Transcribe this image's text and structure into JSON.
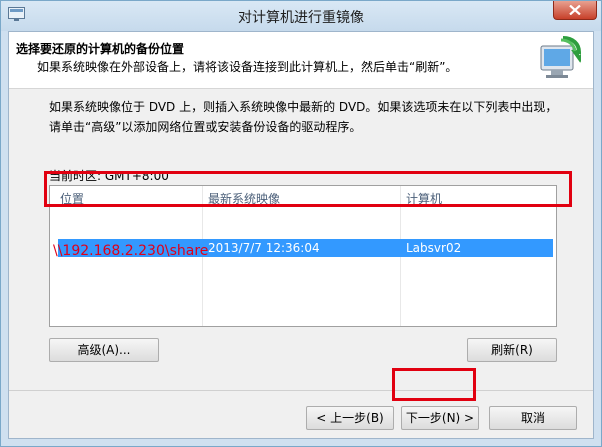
{
  "window": {
    "title": "对计算机进行重镜像"
  },
  "header": {
    "title": "选择要还原的计算机的备份位置",
    "subtitle": "如果系统映像在外部设备上，请将该设备连接到此计算机上，然后单击“刷新”。"
  },
  "description": "如果系统映像位于 DVD 上，则插入系统映像中最新的 DVD。如果该选项未在以下列表中出现，请单击“高级”以添加网络位置或安装备份设备的驱动程序。",
  "timezone": "当前时区: GMT+8:00",
  "table": {
    "columns": [
      "位置",
      "最新系统映像",
      "计算机"
    ],
    "rows": [
      {
        "location": "\\\\192.168.2.230\\share",
        "latest_image": "2013/7/7 12:36:04",
        "computer": "Labsvr02"
      }
    ]
  },
  "buttons": {
    "advanced": "高级(A)...",
    "refresh": "刷新(R)",
    "back": "< 上一步(B)",
    "next": "下一步(N) >",
    "cancel": "取消"
  },
  "colors": {
    "selection": "#3399ff",
    "annotation": "#e10010"
  }
}
